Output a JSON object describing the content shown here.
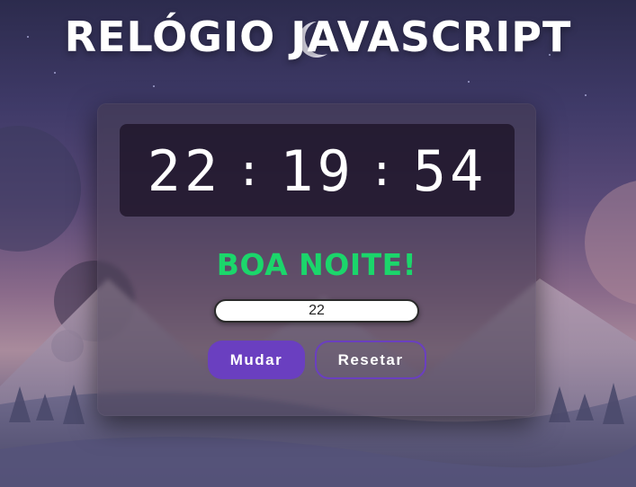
{
  "page": {
    "title": "RELÓGIO JAVASCRIPT"
  },
  "clock": {
    "hours": "22",
    "minutes": "19",
    "seconds": "54",
    "separator": ":"
  },
  "greeting": {
    "text": "BOA NOITE!",
    "color": "#1bd66b"
  },
  "controls": {
    "hour_input_value": "22",
    "change_label": "Mudar",
    "reset_label": "Resetar",
    "accent_color": "#6a3fc0"
  },
  "icons": {
    "moon": "crescent-moon-icon"
  }
}
